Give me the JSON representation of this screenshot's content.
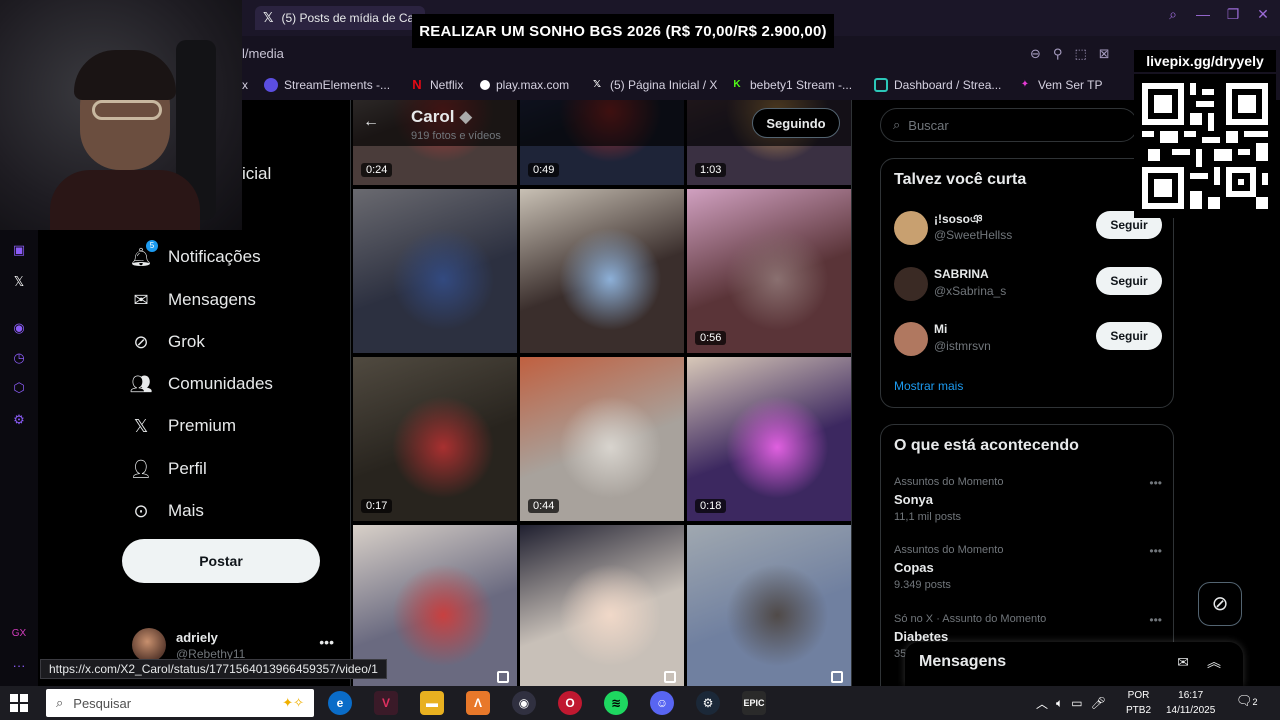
{
  "browser": {
    "tab_title": "(5) Posts de mídia de Ca",
    "url_partial": "l/media",
    "bookmarks": [
      {
        "label": "x",
        "color": "#444"
      },
      {
        "label": "StreamElements -...",
        "color": "#5b4ee0"
      },
      {
        "label": "Netflix",
        "color": "#e50914"
      },
      {
        "label": "play.max.com",
        "color": "#ffffff"
      },
      {
        "label": "(5) Página Inicial / X",
        "color": "#000000"
      },
      {
        "label": "bebety1 Stream -...",
        "color": "#53fc18"
      },
      {
        "label": "Dashboard / Strea...",
        "color": "#2cc7b8"
      },
      {
        "label": "Vem Ser TP",
        "color": "#e43bd3"
      }
    ]
  },
  "overlay": {
    "banner": "REALIZAR UM SONHO BGS 2026 (R$ 70,00/R$ 2.900,00)",
    "qr_label": "livepix.gg/dryyely"
  },
  "nav": {
    "partial_home": "icial",
    "notifications_badge": "5",
    "items": [
      {
        "label": "Notificações",
        "icon": "bell-icon"
      },
      {
        "label": "Mensagens",
        "icon": "mail-icon"
      },
      {
        "label": "Grok",
        "icon": "grok-icon"
      },
      {
        "label": "Comunidades",
        "icon": "people-icon"
      },
      {
        "label": "Premium",
        "icon": "x-icon"
      },
      {
        "label": "Perfil",
        "icon": "person-icon"
      },
      {
        "label": "Mais",
        "icon": "more-circle-icon"
      }
    ],
    "post_button": "Postar",
    "account_name": "adriely",
    "account_handle": "@Rebethy11"
  },
  "profile": {
    "name": "Carol",
    "count": "919 fotos e vídeos",
    "follow_button": "Seguindo"
  },
  "media": {
    "tiles": [
      {
        "duration": "0:24",
        "colors": [
          "#4a3c3a",
          "#b63a3a",
          "#d6d0cc"
        ]
      },
      {
        "duration": "0:49",
        "colors": [
          "#1e2438",
          "#b43030",
          "#3c4a88"
        ]
      },
      {
        "duration": "1:03",
        "colors": [
          "#3a3042",
          "#d4a05a",
          "#8e5a5a"
        ]
      },
      {
        "duration": "",
        "colors": [
          "#2c3040",
          "#334a80",
          "#6a6a70"
        ]
      },
      {
        "duration": "",
        "colors": [
          "#3a2e2c",
          "#8db0d8",
          "#c8c0b4"
        ]
      },
      {
        "duration": "0:56",
        "colors": [
          "#5a3438",
          "#8a7070",
          "#d0a0c0"
        ]
      },
      {
        "duration": "0:17",
        "colors": [
          "#28241e",
          "#a83030",
          "#504a40"
        ]
      },
      {
        "duration": "0:44",
        "colors": [
          "#a8a29c",
          "#d8d4ce",
          "#c06040"
        ]
      },
      {
        "duration": "0:18",
        "colors": [
          "#3c2860",
          "#e060e0",
          "#d8c8b8"
        ]
      },
      {
        "duration": "",
        "colors": [
          "#6a6a80",
          "#c84040",
          "#d8d0c8"
        ]
      },
      {
        "duration": "",
        "colors": [
          "#c8c0b8",
          "#f0d8c8",
          "#202030"
        ]
      },
      {
        "duration": "",
        "colors": [
          "#7080a0",
          "#504a48",
          "#a0a8b0"
        ]
      }
    ]
  },
  "right": {
    "search_placeholder": "Buscar",
    "suggest_title": "Talvez você curta",
    "suggestions": [
      {
        "name": "¡!sosoঞ",
        "handle": "@SweetHellss",
        "button": "Seguir",
        "color": "#c8a070"
      },
      {
        "name": "SABRINA",
        "handle": "@xSabrina_s",
        "button": "Seguir",
        "color": "#3a2a24"
      },
      {
        "name": "Mi",
        "handle": "@istmrsvn",
        "button": "Seguir",
        "color": "#b07860"
      }
    ],
    "show_more": "Mostrar mais",
    "trends_title": "O que está acontecendo",
    "trends": [
      {
        "context": "Assuntos do Momento",
        "title": "Sonya",
        "count": "11,1 mil posts"
      },
      {
        "context": "Assuntos do Momento",
        "title": "Copas",
        "count": "9.349 posts"
      },
      {
        "context": "Só no X · Assunto do Momento",
        "title": "Diabetes",
        "count": "35"
      }
    ],
    "messages_drawer": "Mensagens"
  },
  "status_url": "https://x.com/X2_Carol/status/1771564013966459357/video/1",
  "taskbar": {
    "search_placeholder": "Pesquisar",
    "lang_top": "POR",
    "lang_bottom": "PTB2",
    "time": "16:17",
    "date": "14/11/2025",
    "notif_count": "2"
  }
}
